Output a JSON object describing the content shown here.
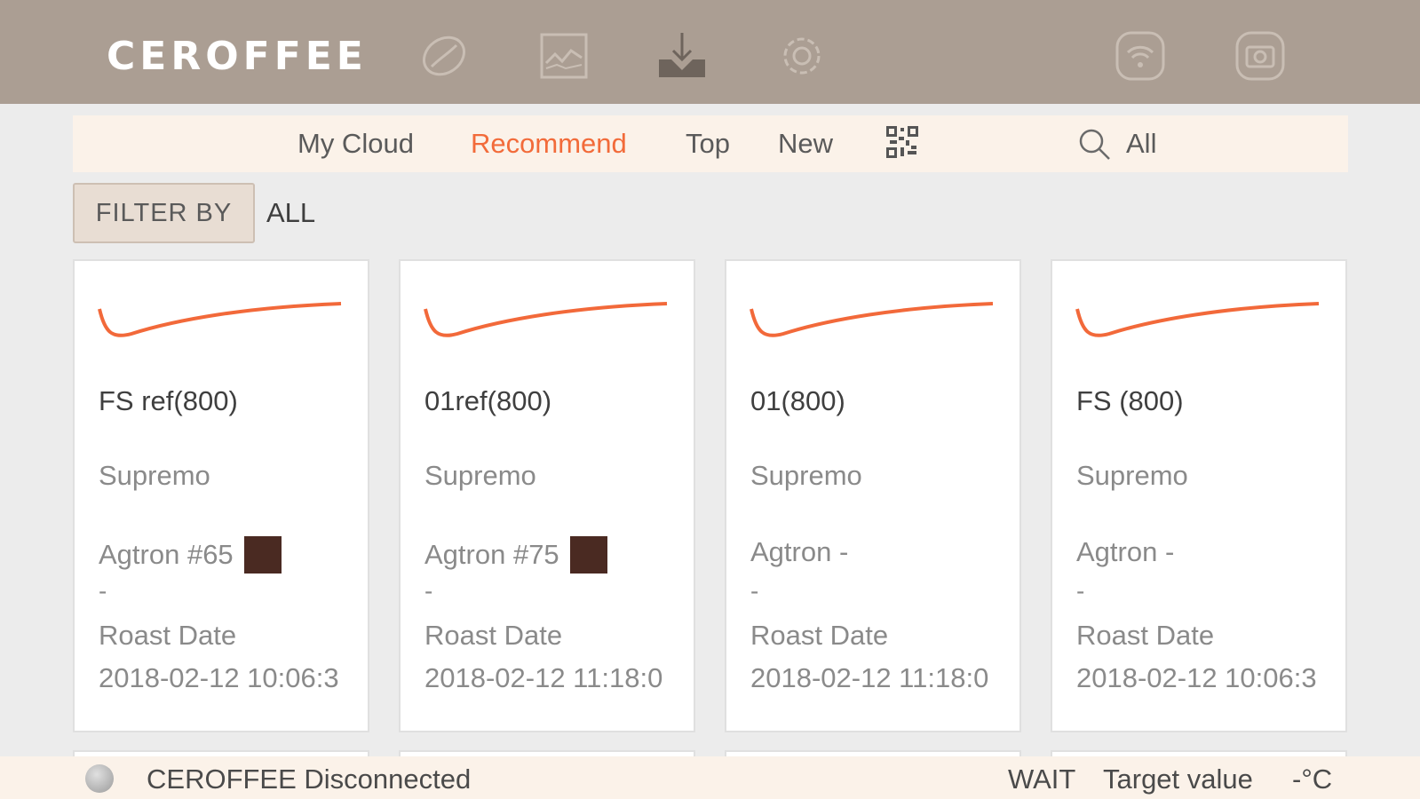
{
  "app": {
    "logo_text": "CEROFFEE"
  },
  "header": {
    "icons": [
      "coffee-bean-icon",
      "chart-icon",
      "download-icon",
      "gear-icon",
      "wifi-icon",
      "camera-icon"
    ]
  },
  "tabs": {
    "items": [
      {
        "label": "My Cloud",
        "active": false
      },
      {
        "label": "Recommend",
        "active": true
      },
      {
        "label": "Top",
        "active": false
      },
      {
        "label": "New",
        "active": false
      }
    ],
    "search_label": "All"
  },
  "filter": {
    "button_label": "FILTER BY",
    "value": "ALL"
  },
  "cards": [
    {
      "name": "FS ref(800)",
      "bean": "Supremo",
      "agtron": "Agtron #65",
      "swatch": "#4a2a22",
      "dash": "-",
      "roast_date_label": "Roast Date",
      "roast_date": "2018-02-12 10:06:3"
    },
    {
      "name": "01ref(800)",
      "bean": "Supremo",
      "agtron": "Agtron #75",
      "swatch": "#4a2a22",
      "dash": "-",
      "roast_date_label": "Roast Date",
      "roast_date": "2018-02-12 11:18:0"
    },
    {
      "name": "01(800)",
      "bean": "Supremo",
      "agtron": "Agtron -",
      "swatch": null,
      "dash": "-",
      "roast_date_label": "Roast Date",
      "roast_date": "2018-02-12 11:18:0"
    },
    {
      "name": "FS (800)",
      "bean": "Supremo",
      "agtron": "Agtron -",
      "swatch": null,
      "dash": "-",
      "roast_date_label": "Roast Date",
      "roast_date": "2018-02-12 10:06:3"
    }
  ],
  "status": {
    "connection": "CEROFFEE Disconnected",
    "state": "WAIT",
    "target_label": "Target value",
    "target_value": "-°C"
  },
  "colors": {
    "header_bg": "#ab9e93",
    "accent": "#f26b3a",
    "strip_bg": "#fbf2e9"
  }
}
